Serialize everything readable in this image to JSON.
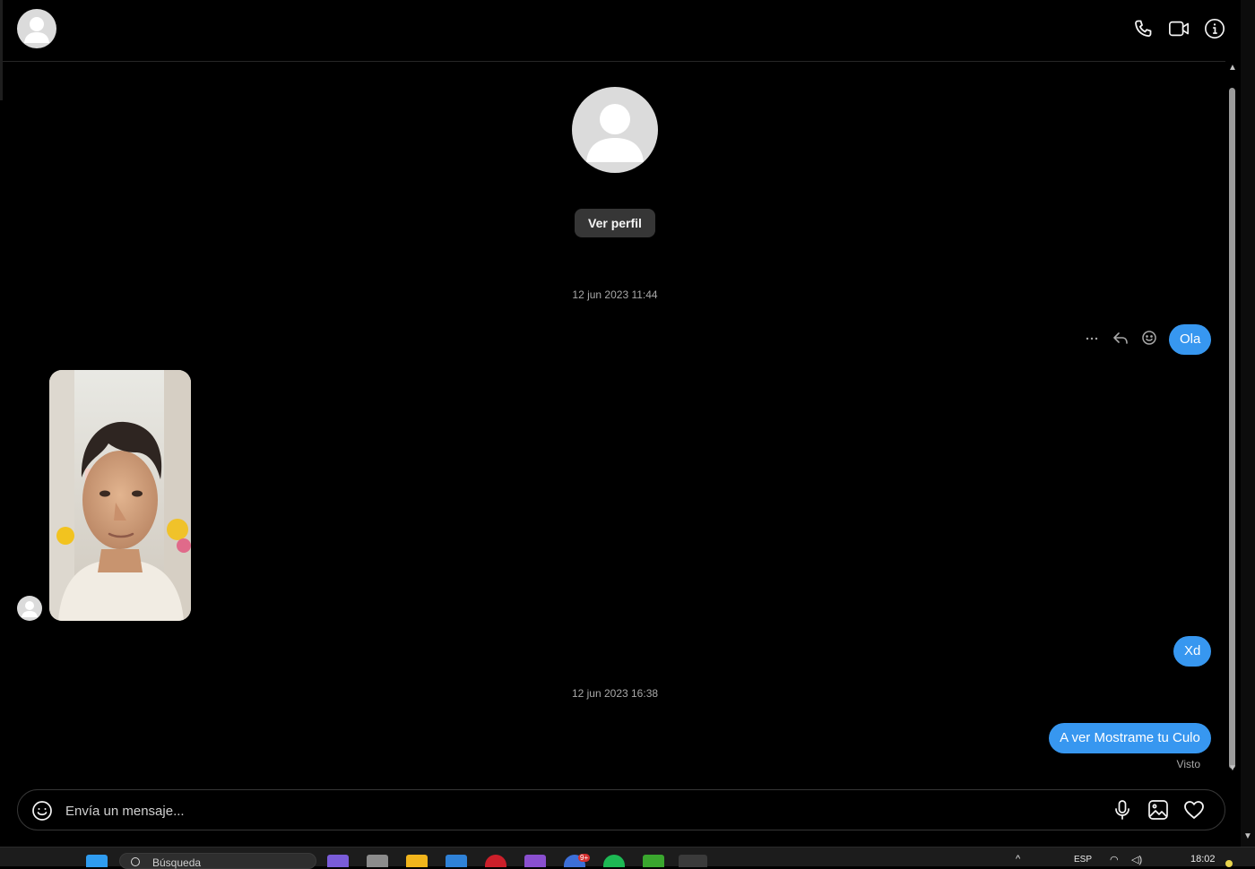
{
  "header": {
    "avatar": "default-avatar",
    "actions": [
      "phone-icon",
      "video-icon",
      "info-icon"
    ]
  },
  "thread": {
    "ver_perfil_label": "Ver perfil",
    "timestamp_1": "12 jun 2023 11:44",
    "timestamp_2": "12 jun 2023 16:38",
    "messages": [
      {
        "from": "me",
        "text": "Ola"
      },
      {
        "from": "them",
        "type": "photo",
        "icon": "selfie-photo"
      },
      {
        "from": "me",
        "text": "Xd"
      },
      {
        "from": "me",
        "text": "A ver Mostrame tu Culo"
      }
    ],
    "hover_actions": [
      "more-icon",
      "reply-icon",
      "react-icon"
    ],
    "seen_label": "Visto"
  },
  "composer": {
    "placeholder": "Envía un mensaje...",
    "value": "",
    "actions": [
      "microphone-icon",
      "image-icon",
      "heart-icon"
    ]
  },
  "taskbar": {
    "search_placeholder": "Búsqueda",
    "language": "ESP",
    "time": "18:02",
    "notification_badge": "9+"
  },
  "colors": {
    "background": "#000000",
    "bubble": "#3797f0",
    "button": "#363636",
    "muted_text": "#a8a8a8"
  }
}
